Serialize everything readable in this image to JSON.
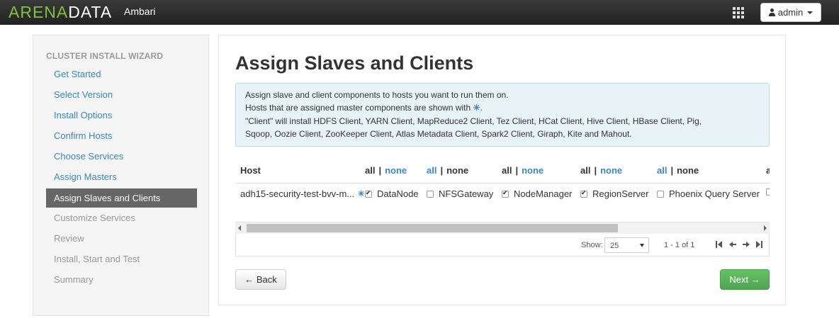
{
  "header": {
    "brand_arena": "ARENA",
    "brand_data": "DATA",
    "app_name": "Ambari",
    "user_label": "admin"
  },
  "sidebar": {
    "title": "CLUSTER INSTALL WIZARD",
    "items": [
      {
        "label": "Get Started",
        "state": "done"
      },
      {
        "label": "Select Version",
        "state": "done"
      },
      {
        "label": "Install Options",
        "state": "done"
      },
      {
        "label": "Confirm Hosts",
        "state": "done"
      },
      {
        "label": "Choose Services",
        "state": "done"
      },
      {
        "label": "Assign Masters",
        "state": "done"
      },
      {
        "label": "Assign Slaves and Clients",
        "state": "active"
      },
      {
        "label": "Customize Services",
        "state": "disabled"
      },
      {
        "label": "Review",
        "state": "disabled"
      },
      {
        "label": "Install, Start and Test",
        "state": "disabled"
      },
      {
        "label": "Summary",
        "state": "disabled"
      }
    ]
  },
  "main": {
    "title": "Assign Slaves and Clients",
    "info_line1": "Assign slave and client components to hosts you want to run them on.",
    "info_line2_pre": "Hosts that are assigned master components are shown with ",
    "info_line2_glyph": "✳",
    "info_line2_post": ".",
    "info_line3": "\"Client\" will install HDFS Client, YARN Client, MapReduce2 Client, Tez Client, HCat Client, Hive Client, HBase Client, Pig,",
    "info_line4": "Sqoop, Oozie Client, ZooKeeper Client, Atlas Metadata Client, Spark2 Client, Giraph, Kite and Mahout."
  },
  "table": {
    "host_header": "Host",
    "all_label": "all",
    "separator": "|",
    "none_label": "none",
    "cut_header": "a",
    "host_name": "adh15-security-test-bvv-m...",
    "master_glyph": "✳",
    "components": [
      {
        "label": "DataNode",
        "checked": true
      },
      {
        "label": "NFSGateway",
        "checked": false
      },
      {
        "label": "NodeManager",
        "checked": true
      },
      {
        "label": "RegionServer",
        "checked": true
      },
      {
        "label": "Phoenix Query Server",
        "checked": false
      }
    ]
  },
  "pager": {
    "show_label": "Show:",
    "page_size": "25",
    "range_text": "1 - 1 of 1"
  },
  "buttons": {
    "back": "← Back",
    "next": "Next →"
  },
  "colors": {
    "brand_green": "#7ec13a",
    "link_blue": "#3a87c0",
    "active_nav": "#666666",
    "next_green": "#51a351",
    "info_bg": "#e8f3f8"
  }
}
